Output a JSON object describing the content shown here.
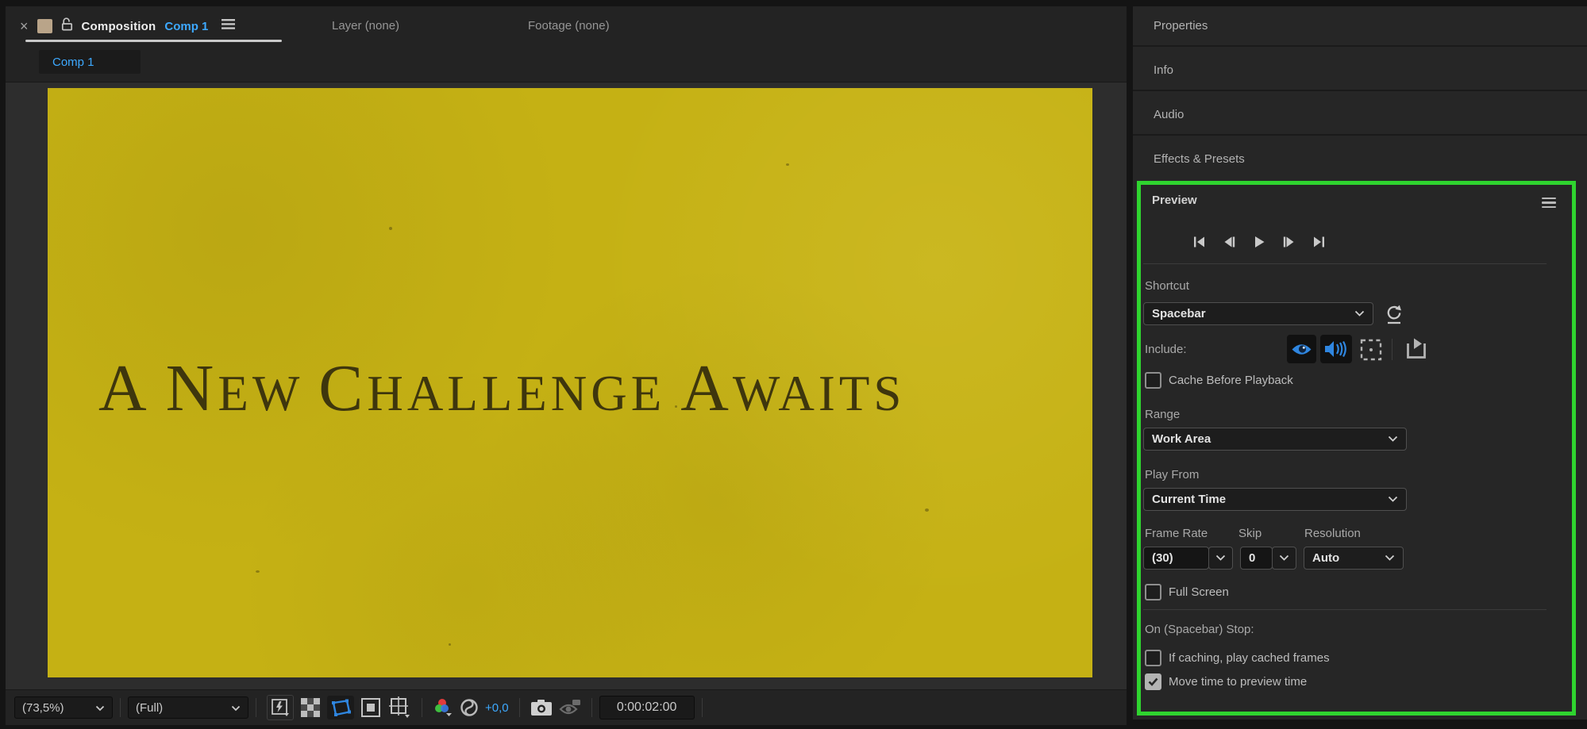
{
  "colors": {
    "accent_blue": "#3da9ff",
    "icon_blue": "#2f86e0",
    "highlight_green": "#2fd42f",
    "panel_bg": "#232323",
    "right_panel_bg": "#262626",
    "canvas_yellow": "#c5b114",
    "title_text": "#3e360d"
  },
  "comp_panel": {
    "tab_bar": {
      "close": "×",
      "composition_label": "Composition",
      "comp_name": "Comp 1",
      "layer_tab": "Layer (none)",
      "footage_tab": "Footage (none)"
    },
    "comp_tab": "Comp 1",
    "canvas": {
      "title_parts": [
        {
          "big": "A",
          "small": ""
        },
        {
          "big": "N",
          "small": "ew"
        },
        {
          "big": "C",
          "small": "hallenge"
        },
        {
          "big": "A",
          "small": "waits"
        }
      ]
    },
    "toolbar": {
      "zoom_value": "(73,5%)",
      "resolution_value": "(Full)",
      "exposure_value": "+0,0",
      "timecode": "0:00:02:00",
      "icons": [
        "fast-previews-icon",
        "transparency-grid-icon",
        "mask-visibility-icon",
        "region-of-interest-icon",
        "grid-guides-icon",
        "channels-icon",
        "exposure-icon",
        "snapshot-icon",
        "show-snapshot-icon"
      ]
    }
  },
  "right_panel": {
    "collapsed_panels": [
      "Properties",
      "Info",
      "Audio",
      "Effects & Presets"
    ],
    "preview": {
      "title": "Preview",
      "menu_icon": "hamburger-icon",
      "transport_icons": [
        "first-frame-icon",
        "previous-frame-icon",
        "play-icon",
        "next-frame-icon",
        "last-frame-icon"
      ],
      "shortcut_label": "Shortcut",
      "shortcut_value": "Spacebar",
      "reset_icon": "reset-icon",
      "include_label": "Include:",
      "include_icons": [
        "video-eye-icon",
        "audio-speaker-icon",
        "overlays-icon",
        "layer-controls-icon"
      ],
      "cache_label": "Cache Before Playback",
      "cache_checked": false,
      "range_label": "Range",
      "range_value": "Work Area",
      "play_from_label": "Play From",
      "play_from_value": "Current Time",
      "frame_rate_label": "Frame Rate",
      "frame_rate_value": "(30)",
      "skip_label": "Skip",
      "skip_value": "0",
      "resolution_label": "Resolution",
      "resolution_value": "Auto",
      "full_screen_label": "Full Screen",
      "full_screen_checked": false,
      "on_stop_label": "On (Spacebar) Stop:",
      "if_caching_label": "If caching, play cached frames",
      "if_caching_checked": false,
      "move_time_label": "Move time to preview time",
      "move_time_checked": true
    }
  }
}
